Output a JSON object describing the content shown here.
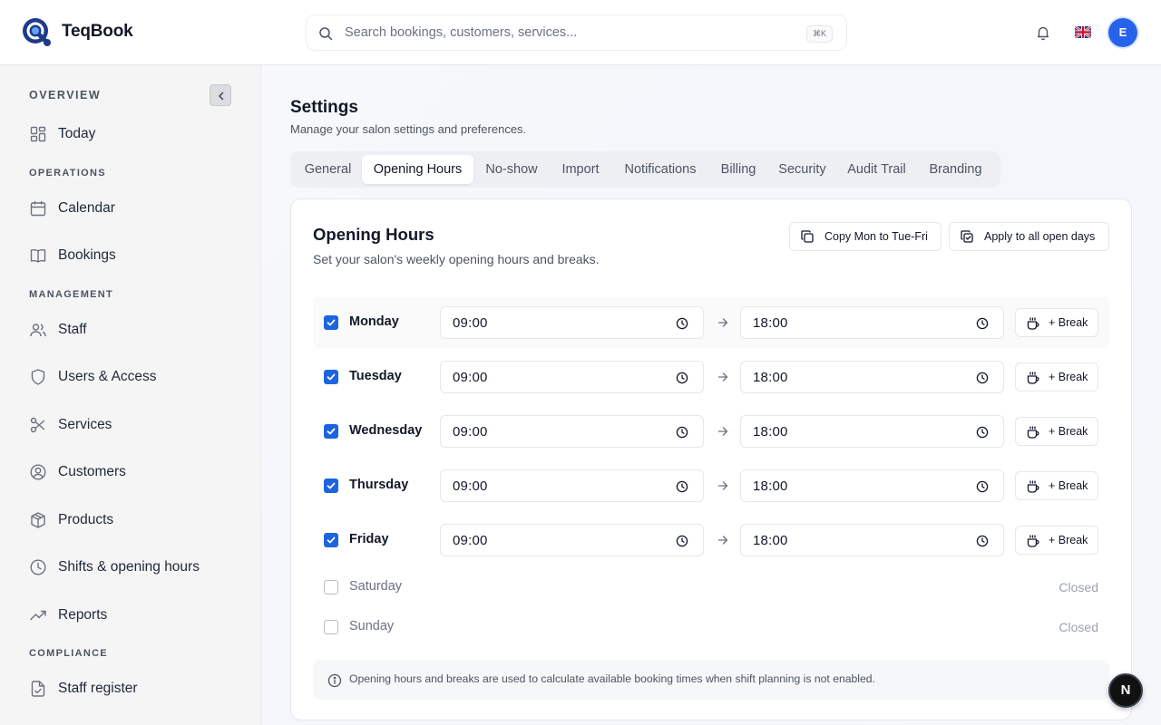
{
  "header": {
    "brand": "TeqBook",
    "search_placeholder": "Search bookings, customers, services...",
    "shortcut": "⌘K",
    "avatar_initial": "E"
  },
  "sidebar": {
    "sections": [
      {
        "label": "OVERVIEW",
        "items": [
          {
            "label": "Today",
            "icon": "grid-icon"
          }
        ]
      },
      {
        "label": "OPERATIONS",
        "items": [
          {
            "label": "Calendar",
            "icon": "calendar-icon"
          },
          {
            "label": "Bookings",
            "icon": "book-icon"
          }
        ]
      },
      {
        "label": "MANAGEMENT",
        "items": [
          {
            "label": "Staff",
            "icon": "users-icon"
          },
          {
            "label": "Users & Access",
            "icon": "shield-icon"
          },
          {
            "label": "Services",
            "icon": "scissors-icon"
          },
          {
            "label": "Customers",
            "icon": "user-circle-icon"
          },
          {
            "label": "Products",
            "icon": "box-icon"
          },
          {
            "label": "Shifts & opening hours",
            "icon": "clock-icon"
          },
          {
            "label": "Reports",
            "icon": "trending-up-icon"
          }
        ]
      },
      {
        "label": "COMPLIANCE",
        "items": [
          {
            "label": "Staff register",
            "icon": "file-check-icon"
          }
        ]
      }
    ]
  },
  "page": {
    "title": "Settings",
    "subtitle": "Manage your salon settings and preferences.",
    "tabs": [
      "General",
      "Opening Hours",
      "No-show",
      "Import",
      "Notifications",
      "Billing",
      "Security",
      "Audit Trail",
      "Branding"
    ],
    "active_tab": "Opening Hours"
  },
  "card": {
    "title": "Opening Hours",
    "subtitle": "Set your salon's weekly opening hours and breaks.",
    "copy_button": "Copy Mon to Tue-Fri",
    "apply_button": "Apply to all open days",
    "break_label": "+ Break",
    "closed_label": "Closed",
    "days": [
      {
        "name": "Monday",
        "open": true,
        "start": "09:00",
        "end": "18:00"
      },
      {
        "name": "Tuesday",
        "open": true,
        "start": "09:00",
        "end": "18:00"
      },
      {
        "name": "Wednesday",
        "open": true,
        "start": "09:00",
        "end": "18:00"
      },
      {
        "name": "Thursday",
        "open": true,
        "start": "09:00",
        "end": "18:00"
      },
      {
        "name": "Friday",
        "open": true,
        "start": "09:00",
        "end": "18:00"
      },
      {
        "name": "Saturday",
        "open": false
      },
      {
        "name": "Sunday",
        "open": false
      }
    ],
    "note": "Opening hours and breaks are used to calculate available booking times when shift planning is not enabled."
  },
  "fab_label": "N",
  "colors": {
    "accent": "#1d64e0",
    "avatar": "#2563eb"
  }
}
